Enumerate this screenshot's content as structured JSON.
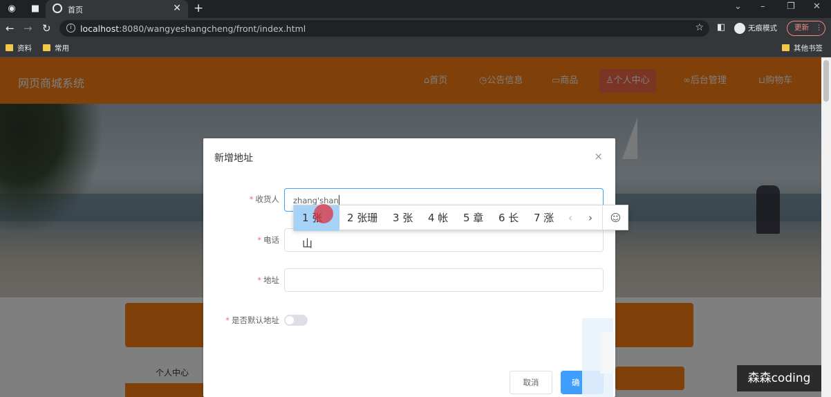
{
  "browser": {
    "tab_title": "首页",
    "new_tab_symbol": "+",
    "url_host": "localhost",
    "url_rest": ":8080/wangyeshangcheng/front/index.html",
    "incognito_label": "无痕模式",
    "update_label": "更新",
    "bookmarks": [
      "资料",
      "常用"
    ],
    "other_bookmarks": "其他书签"
  },
  "site": {
    "title": "网页商城系统",
    "nav": [
      {
        "icon": "home-icon",
        "label": "首页"
      },
      {
        "icon": "notice-icon",
        "label": "公告信息"
      },
      {
        "icon": "shop-icon",
        "label": "商品"
      },
      {
        "icon": "user-icon",
        "label": "个人中心"
      },
      {
        "icon": "link-icon",
        "label": "后台管理"
      },
      {
        "icon": "cart-icon",
        "label": "购物车"
      }
    ],
    "side_menu_label": "个人中心"
  },
  "dialog": {
    "title": "新增地址",
    "close_symbol": "×",
    "fields": [
      {
        "label": "收货人",
        "value": "zhang'shan",
        "required": true
      },
      {
        "label": "电话",
        "value": "",
        "required": true
      },
      {
        "label": "地址",
        "value": "",
        "required": true
      }
    ],
    "default_label": "是否默认地址",
    "default_on": false,
    "cancel_label": "取消",
    "confirm_label": "确"
  },
  "ime": {
    "candidates": [
      "1 张山",
      "2 张珊",
      "3 张",
      "4 帐",
      "5 章",
      "6 长",
      "7 涨"
    ],
    "selected_index": 0,
    "prev_symbol": "‹",
    "next_symbol": "›",
    "emoji_symbol": "☺"
  },
  "watermark": "森森coding",
  "colors": {
    "header_orange": "#fe8113",
    "nav_active": "#f66b4a",
    "primary_blue": "#409eff",
    "required_red": "#f56c6c"
  }
}
